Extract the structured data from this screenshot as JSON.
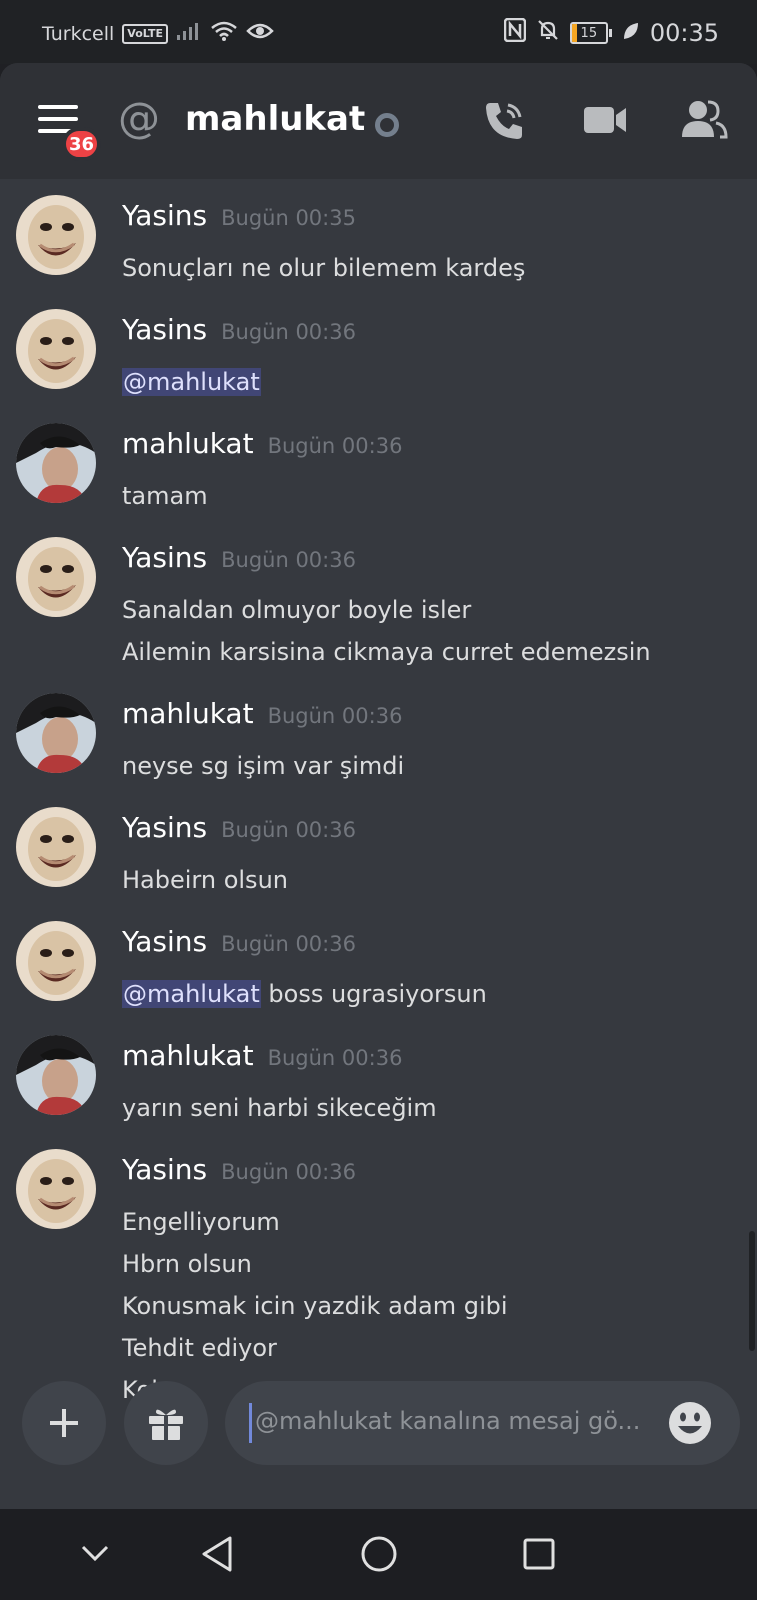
{
  "status_bar": {
    "carrier": "Turkcell",
    "volte": "VoLTE",
    "battery": "15",
    "battery_fraction": 0.15,
    "time": "00:35",
    "icons": [
      "signal-icon",
      "wifi-icon",
      "eye-icon",
      "nfc-icon",
      "mute-icon",
      "battery-icon",
      "leaf-icon"
    ]
  },
  "header": {
    "badge_count": "36",
    "at_symbol": "@",
    "channel_name": "mahlukat",
    "icons": [
      "menu-icon",
      "at-icon",
      "status-dot",
      "voice-call-icon",
      "video-call-icon",
      "members-icon"
    ]
  },
  "colors": {
    "background": "#36393f",
    "header": "#2f3136",
    "mention_bg": "#414675",
    "badge": "#ed4245",
    "accent": "#7289da"
  },
  "messages": [
    {
      "author": "Yasins",
      "timestamp": "Bugün 00:35",
      "avatar": "ostrich-avatar",
      "lines": [
        [
          {
            "text": "Sonuçları ne olur bilemem kardeş"
          }
        ]
      ]
    },
    {
      "author": "Yasins",
      "timestamp": "Bugün 00:36",
      "avatar": "ostrich-avatar",
      "lines": [
        [
          {
            "text": "@mahlukat",
            "mention": true
          }
        ]
      ]
    },
    {
      "author": "mahlukat",
      "timestamp": "Bugün 00:36",
      "avatar": "person-avatar",
      "lines": [
        [
          {
            "text": "tamam"
          }
        ]
      ]
    },
    {
      "author": "Yasins",
      "timestamp": "Bugün 00:36",
      "avatar": "ostrich-avatar",
      "lines": [
        [
          {
            "text": "Sanaldan olmuyor boyle isler"
          }
        ],
        [
          {
            "text": "Ailemin karsisina cikmaya curret edemezsin"
          }
        ]
      ]
    },
    {
      "author": "mahlukat",
      "timestamp": "Bugün 00:36",
      "avatar": "person-avatar",
      "lines": [
        [
          {
            "text": "neyse sg işim var şimdi"
          }
        ]
      ]
    },
    {
      "author": "Yasins",
      "timestamp": "Bugün 00:36",
      "avatar": "ostrich-avatar",
      "lines": [
        [
          {
            "text": "Habeirn olsun"
          }
        ]
      ]
    },
    {
      "author": "Yasins",
      "timestamp": "Bugün 00:36",
      "avatar": "ostrich-avatar",
      "lines": [
        [
          {
            "text": "@mahlukat",
            "mention": true
          },
          {
            "text": " boss ugrasiyorsun"
          }
        ]
      ]
    },
    {
      "author": "mahlukat",
      "timestamp": "Bugün 00:36",
      "avatar": "person-avatar",
      "lines": [
        [
          {
            "text": "yarın seni harbi sikeceğim"
          }
        ]
      ]
    },
    {
      "author": "Yasins",
      "timestamp": "Bugün 00:36",
      "avatar": "ostrich-avatar",
      "lines": [
        [
          {
            "text": "Engelliyorum"
          }
        ],
        [
          {
            "text": "Hbrn olsun"
          }
        ],
        [
          {
            "text": "Konusmak icin yazdik adam gibi"
          }
        ],
        [
          {
            "text": "Tehdit ediyor"
          }
        ],
        [
          {
            "text": "Kolpa"
          }
        ]
      ]
    }
  ],
  "composer": {
    "placeholder": "@mahlukat kanalına mesaj gö...",
    "icons": [
      "plus-icon",
      "gift-icon",
      "emoji-icon"
    ]
  },
  "nav_bar": {
    "icons": [
      "chevron-down-icon",
      "back-icon",
      "home-icon",
      "recents-icon"
    ]
  }
}
